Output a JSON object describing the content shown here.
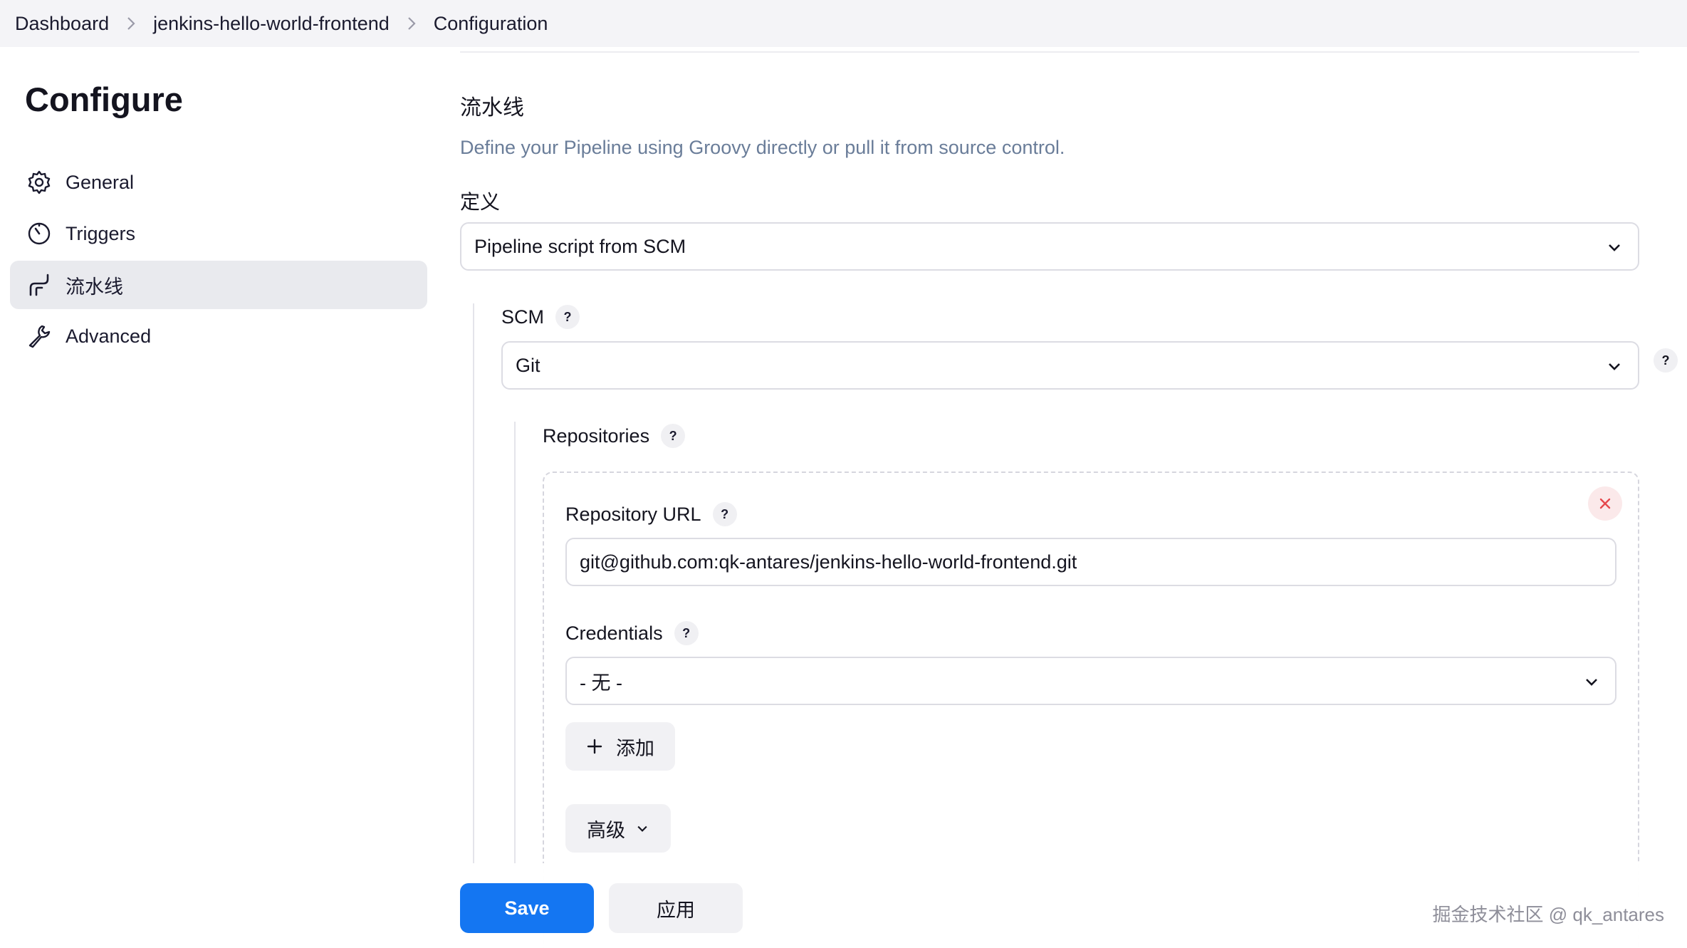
{
  "breadcrumb": {
    "items": [
      "Dashboard",
      "jenkins-hello-world-frontend",
      "Configuration"
    ]
  },
  "sidebar": {
    "title": "Configure",
    "items": [
      {
        "label": "General",
        "icon": "gear-icon"
      },
      {
        "label": "Triggers",
        "icon": "clock-icon"
      },
      {
        "label": "流水线",
        "icon": "pipeline-icon",
        "active": true
      },
      {
        "label": "Advanced",
        "icon": "wrench-icon"
      }
    ]
  },
  "pipeline": {
    "title": "流水线",
    "description": "Define your Pipeline using Groovy directly or pull it from source control.",
    "definition_label": "定义",
    "definition_value": "Pipeline script from SCM",
    "scm_label": "SCM",
    "scm_value": "Git",
    "help_glyph": "?",
    "repositories_label": "Repositories",
    "repo_url_label": "Repository URL",
    "repo_url_value": "git@github.com:qk-antares/jenkins-hello-world-frontend.git",
    "credentials_label": "Credentials",
    "credentials_value": "- 无 -",
    "add_label": "添加",
    "advanced_label": "高级"
  },
  "actions": {
    "save_label": "Save",
    "apply_label": "应用"
  },
  "watermark": "掘金技术社区 @ qk_antares",
  "colors": {
    "primary": "#1476f2",
    "active_bg": "#e9eaee",
    "description": "#6a7d99",
    "danger": "#e5484d"
  }
}
